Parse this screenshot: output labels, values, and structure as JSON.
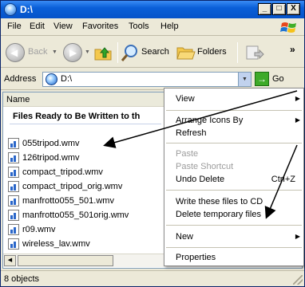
{
  "window": {
    "title": "D:\\"
  },
  "title_buttons": {
    "minimize": "_",
    "maximize": "□",
    "close": "X"
  },
  "menubar": [
    "File",
    "Edit",
    "View",
    "Favorites",
    "Tools",
    "Help"
  ],
  "toolbar": {
    "back": "Back",
    "search": "Search",
    "folders": "Folders",
    "overflow": "»"
  },
  "address": {
    "label": "Address",
    "value": "D:\\",
    "go": "Go"
  },
  "columns": {
    "name": "Name"
  },
  "group_title": "Files Ready to Be Written to th",
  "files": [
    "055tripod.wmv",
    "126tripod.wmv",
    "compact_tripod.wmv",
    "compact_tripod_orig.wmv",
    "manfrotto055_501.wmv",
    "manfrotto055_501orig.wmv",
    "r09.wmv",
    "wireless_lav.wmv"
  ],
  "status": {
    "text": "8 objects"
  },
  "context_menu": {
    "items": [
      {
        "label": "View",
        "submenu": true
      },
      {
        "label": "Arrange Icons By",
        "submenu": true
      },
      {
        "label": "Refresh"
      },
      {
        "label": "Paste",
        "disabled": true
      },
      {
        "label": "Paste Shortcut",
        "disabled": true
      },
      {
        "label": "Undo Delete",
        "shortcut": "Ctrl+Z"
      },
      {
        "label": "Write these files to CD"
      },
      {
        "label": "Delete temporary files"
      },
      {
        "label": "New",
        "submenu": true
      },
      {
        "label": "Properties"
      }
    ]
  },
  "colors": {
    "titlebar": "#0553c9",
    "window_bg": "#ece9d8",
    "annotation_arrows": "#000000"
  }
}
